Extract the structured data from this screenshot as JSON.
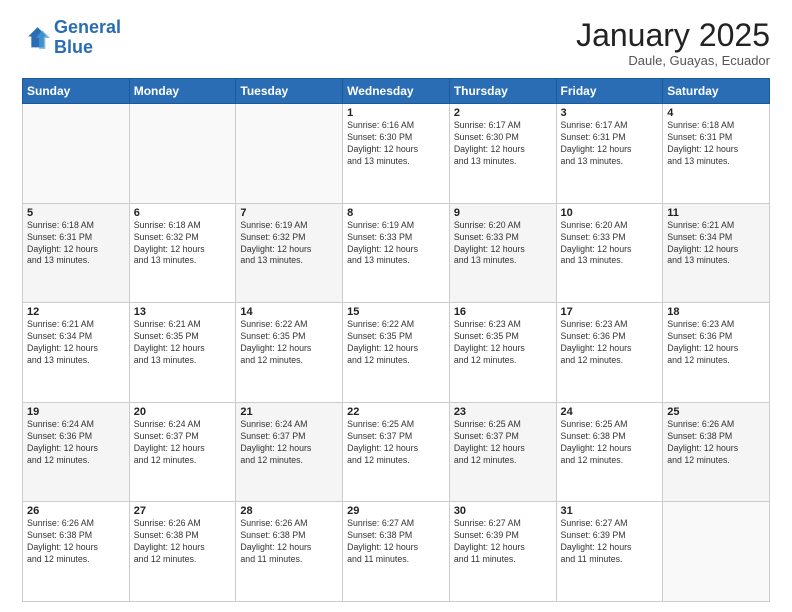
{
  "header": {
    "logo_line1": "General",
    "logo_line2": "Blue",
    "title": "January 2025",
    "location": "Daule, Guayas, Ecuador"
  },
  "weekdays": [
    "Sunday",
    "Monday",
    "Tuesday",
    "Wednesday",
    "Thursday",
    "Friday",
    "Saturday"
  ],
  "weeks": [
    [
      {
        "day": "",
        "info": ""
      },
      {
        "day": "",
        "info": ""
      },
      {
        "day": "",
        "info": ""
      },
      {
        "day": "1",
        "info": "Sunrise: 6:16 AM\nSunset: 6:30 PM\nDaylight: 12 hours\nand 13 minutes."
      },
      {
        "day": "2",
        "info": "Sunrise: 6:17 AM\nSunset: 6:30 PM\nDaylight: 12 hours\nand 13 minutes."
      },
      {
        "day": "3",
        "info": "Sunrise: 6:17 AM\nSunset: 6:31 PM\nDaylight: 12 hours\nand 13 minutes."
      },
      {
        "day": "4",
        "info": "Sunrise: 6:18 AM\nSunset: 6:31 PM\nDaylight: 12 hours\nand 13 minutes."
      }
    ],
    [
      {
        "day": "5",
        "info": "Sunrise: 6:18 AM\nSunset: 6:31 PM\nDaylight: 12 hours\nand 13 minutes."
      },
      {
        "day": "6",
        "info": "Sunrise: 6:18 AM\nSunset: 6:32 PM\nDaylight: 12 hours\nand 13 minutes."
      },
      {
        "day": "7",
        "info": "Sunrise: 6:19 AM\nSunset: 6:32 PM\nDaylight: 12 hours\nand 13 minutes."
      },
      {
        "day": "8",
        "info": "Sunrise: 6:19 AM\nSunset: 6:33 PM\nDaylight: 12 hours\nand 13 minutes."
      },
      {
        "day": "9",
        "info": "Sunrise: 6:20 AM\nSunset: 6:33 PM\nDaylight: 12 hours\nand 13 minutes."
      },
      {
        "day": "10",
        "info": "Sunrise: 6:20 AM\nSunset: 6:33 PM\nDaylight: 12 hours\nand 13 minutes."
      },
      {
        "day": "11",
        "info": "Sunrise: 6:21 AM\nSunset: 6:34 PM\nDaylight: 12 hours\nand 13 minutes."
      }
    ],
    [
      {
        "day": "12",
        "info": "Sunrise: 6:21 AM\nSunset: 6:34 PM\nDaylight: 12 hours\nand 13 minutes."
      },
      {
        "day": "13",
        "info": "Sunrise: 6:21 AM\nSunset: 6:35 PM\nDaylight: 12 hours\nand 13 minutes."
      },
      {
        "day": "14",
        "info": "Sunrise: 6:22 AM\nSunset: 6:35 PM\nDaylight: 12 hours\nand 12 minutes."
      },
      {
        "day": "15",
        "info": "Sunrise: 6:22 AM\nSunset: 6:35 PM\nDaylight: 12 hours\nand 12 minutes."
      },
      {
        "day": "16",
        "info": "Sunrise: 6:23 AM\nSunset: 6:35 PM\nDaylight: 12 hours\nand 12 minutes."
      },
      {
        "day": "17",
        "info": "Sunrise: 6:23 AM\nSunset: 6:36 PM\nDaylight: 12 hours\nand 12 minutes."
      },
      {
        "day": "18",
        "info": "Sunrise: 6:23 AM\nSunset: 6:36 PM\nDaylight: 12 hours\nand 12 minutes."
      }
    ],
    [
      {
        "day": "19",
        "info": "Sunrise: 6:24 AM\nSunset: 6:36 PM\nDaylight: 12 hours\nand 12 minutes."
      },
      {
        "day": "20",
        "info": "Sunrise: 6:24 AM\nSunset: 6:37 PM\nDaylight: 12 hours\nand 12 minutes."
      },
      {
        "day": "21",
        "info": "Sunrise: 6:24 AM\nSunset: 6:37 PM\nDaylight: 12 hours\nand 12 minutes."
      },
      {
        "day": "22",
        "info": "Sunrise: 6:25 AM\nSunset: 6:37 PM\nDaylight: 12 hours\nand 12 minutes."
      },
      {
        "day": "23",
        "info": "Sunrise: 6:25 AM\nSunset: 6:37 PM\nDaylight: 12 hours\nand 12 minutes."
      },
      {
        "day": "24",
        "info": "Sunrise: 6:25 AM\nSunset: 6:38 PM\nDaylight: 12 hours\nand 12 minutes."
      },
      {
        "day": "25",
        "info": "Sunrise: 6:26 AM\nSunset: 6:38 PM\nDaylight: 12 hours\nand 12 minutes."
      }
    ],
    [
      {
        "day": "26",
        "info": "Sunrise: 6:26 AM\nSunset: 6:38 PM\nDaylight: 12 hours\nand 12 minutes."
      },
      {
        "day": "27",
        "info": "Sunrise: 6:26 AM\nSunset: 6:38 PM\nDaylight: 12 hours\nand 12 minutes."
      },
      {
        "day": "28",
        "info": "Sunrise: 6:26 AM\nSunset: 6:38 PM\nDaylight: 12 hours\nand 11 minutes."
      },
      {
        "day": "29",
        "info": "Sunrise: 6:27 AM\nSunset: 6:38 PM\nDaylight: 12 hours\nand 11 minutes."
      },
      {
        "day": "30",
        "info": "Sunrise: 6:27 AM\nSunset: 6:39 PM\nDaylight: 12 hours\nand 11 minutes."
      },
      {
        "day": "31",
        "info": "Sunrise: 6:27 AM\nSunset: 6:39 PM\nDaylight: 12 hours\nand 11 minutes."
      },
      {
        "day": "",
        "info": ""
      }
    ]
  ]
}
